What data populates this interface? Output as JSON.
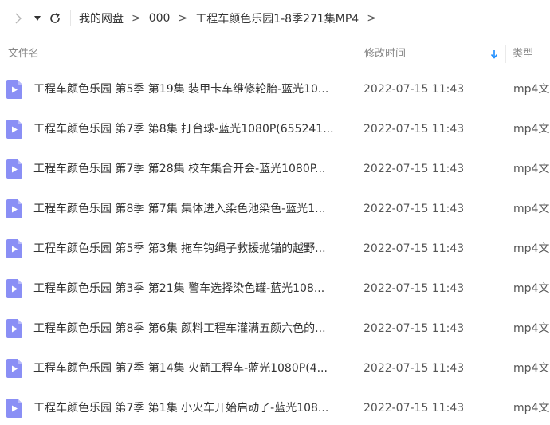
{
  "toolbar": {
    "breadcrumb": [
      "我的网盘",
      "000",
      "工程车颜色乐园1-8季271集MP4"
    ],
    "crumb_separator": ">",
    "trailing_separator": ">"
  },
  "columns": {
    "name": "文件名",
    "modified": "修改时间",
    "type": "类型"
  },
  "icons": {
    "forward": "chevron-right-icon",
    "dropdown": "caret-down-icon",
    "refresh": "refresh-icon",
    "sort": "sort-down-arrow-icon",
    "file": "video-file-icon"
  },
  "colors": {
    "accent": "#1a8cff",
    "file_icon": "#8a8ff5"
  },
  "files": [
    {
      "name": "工程车颜色乐园 第5季 第19集 装甲卡车维修轮胎-蓝光10...",
      "modified": "2022-07-15 11:43",
      "type": "mp4文"
    },
    {
      "name": "工程车颜色乐园 第7季 第8集 打台球-蓝光1080P(655241...",
      "modified": "2022-07-15 11:43",
      "type": "mp4文"
    },
    {
      "name": "工程车颜色乐园 第7季 第28集 校车集合开会-蓝光1080P...",
      "modified": "2022-07-15 11:43",
      "type": "mp4文"
    },
    {
      "name": "工程车颜色乐园 第8季 第7集 集体进入染色池染色-蓝光1...",
      "modified": "2022-07-15 11:43",
      "type": "mp4文"
    },
    {
      "name": "工程车颜色乐园 第5季 第3集 拖车钩绳子救援抛锚的越野...",
      "modified": "2022-07-15 11:43",
      "type": "mp4文"
    },
    {
      "name": "工程车颜色乐园 第3季 第21集 警车选择染色罐-蓝光108...",
      "modified": "2022-07-15 11:43",
      "type": "mp4文"
    },
    {
      "name": "工程车颜色乐园 第8季 第6集 颜料工程车灌满五颜六色的...",
      "modified": "2022-07-15 11:43",
      "type": "mp4文"
    },
    {
      "name": "工程车颜色乐园 第7季 第14集 火箭工程车-蓝光1080P(4...",
      "modified": "2022-07-15 11:43",
      "type": "mp4文"
    },
    {
      "name": "工程车颜色乐园 第7季 第1集 小火车开始启动了-蓝光108...",
      "modified": "2022-07-15 11:43",
      "type": "mp4文"
    }
  ]
}
